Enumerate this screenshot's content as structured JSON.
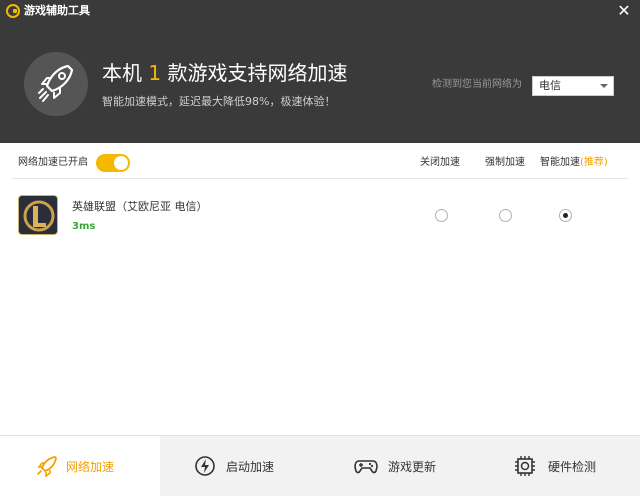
{
  "window": {
    "title": "游戏辅助工具",
    "close_glyph": "✕"
  },
  "hero": {
    "headline_prefix": "本机 ",
    "game_count": "1",
    "headline_suffix": " 款游戏支持网络加速",
    "subline": "智能加速模式，延迟最大降低98%，极速体验！",
    "icon": "rocket-icon",
    "detect_label": "检测到您当前网络为",
    "isp_value": "电信"
  },
  "options": {
    "toggle_label": "网络加速已开启",
    "toggle_on": true,
    "columns": [
      {
        "label": "关闭加速",
        "extra": ""
      },
      {
        "label": "强制加速",
        "extra": ""
      },
      {
        "label": "智能加速",
        "extra": "(推荐)"
      }
    ]
  },
  "games": [
    {
      "name": "英雄联盟（艾欧尼亚 电信）",
      "ping": "3ms",
      "icon": "league-of-legends-icon",
      "selected_mode": 2
    }
  ],
  "nav": [
    {
      "label": "网络加速",
      "icon": "rocket-icon",
      "active": true
    },
    {
      "label": "启动加速",
      "icon": "lightning-icon",
      "active": false
    },
    {
      "label": "游戏更新",
      "icon": "gamepad-icon",
      "active": false
    },
    {
      "label": "硬件检测",
      "icon": "chip-icon",
      "active": false
    }
  ],
  "colors": {
    "header_bg": "#3a3a3a",
    "accent": "#f5b800",
    "ping_green": "#3aa63a"
  }
}
